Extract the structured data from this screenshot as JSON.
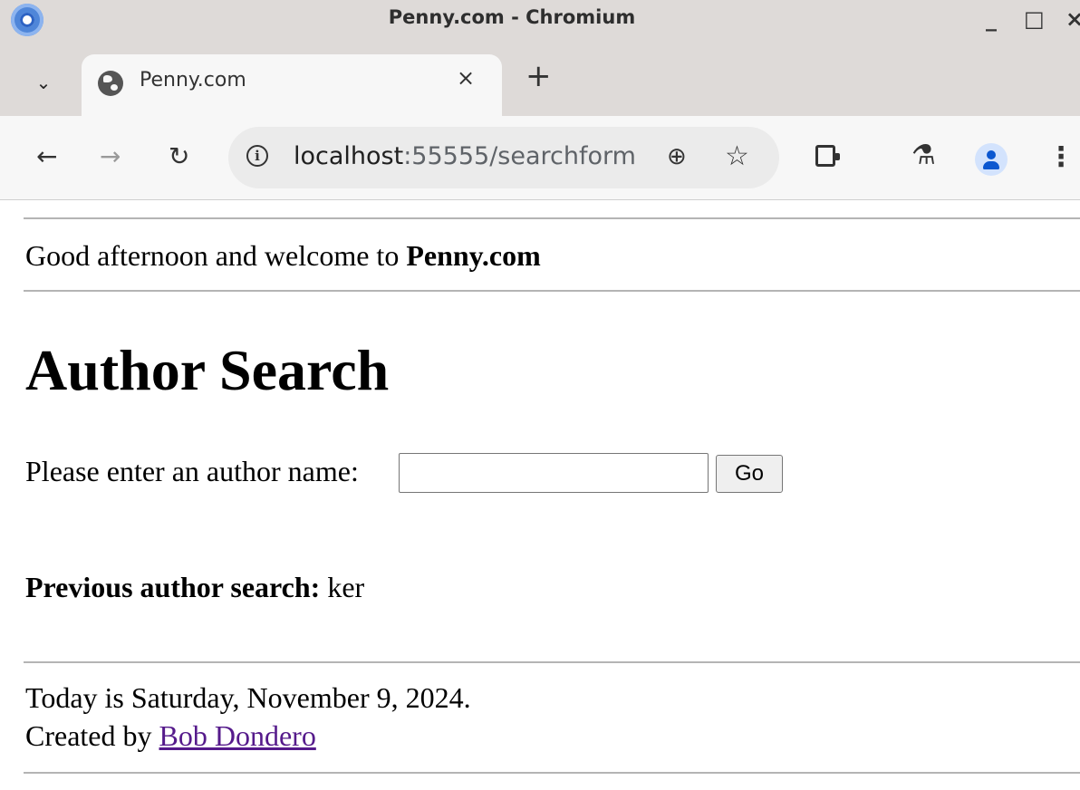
{
  "window": {
    "title": "Penny.com - Chromium",
    "minimize_label": "_",
    "maximize_label": "□",
    "close_label": "×"
  },
  "tabs": [
    {
      "title": "Penny.com",
      "active": true
    }
  ],
  "tabstrip": {
    "list_label": "⌄",
    "close_label": "×",
    "new_tab_label": "+"
  },
  "toolbar": {
    "back_label": "←",
    "forward_label": "→",
    "reload_label": "↻",
    "url_host": "localhost",
    "url_rest": ":55555/searchform",
    "zoom_label": "⊕",
    "star_label": "☆",
    "labs_label": "⚗",
    "menu_label": "⋮",
    "icons": [
      "back-icon",
      "forward-icon",
      "reload-icon",
      "info-icon",
      "zoom-icon",
      "bookmark-star-icon",
      "extensions-icon",
      "labs-icon",
      "profile-avatar",
      "menu-icon"
    ]
  },
  "page": {
    "greeting_prefix": "Good afternoon and welcome to ",
    "greeting_site": "Penny.com",
    "title": "Author Search",
    "search_label": "Please enter an author name:",
    "search_value": "",
    "go_label": "Go",
    "prev_search_label": "Previous author search:",
    "prev_search_value": "ker",
    "date_line": "Today is Saturday, November 9, 2024.",
    "created_by_prefix": "Created by ",
    "created_by_name": "Bob Dondero"
  },
  "colors": {
    "titlebar_bg": "#dedad8",
    "toolbar_bg": "#f7f7f7",
    "omnibox_bg": "#ebebeb",
    "visited_link": "#551a8b",
    "avatar_accent": "#0b57d0"
  }
}
